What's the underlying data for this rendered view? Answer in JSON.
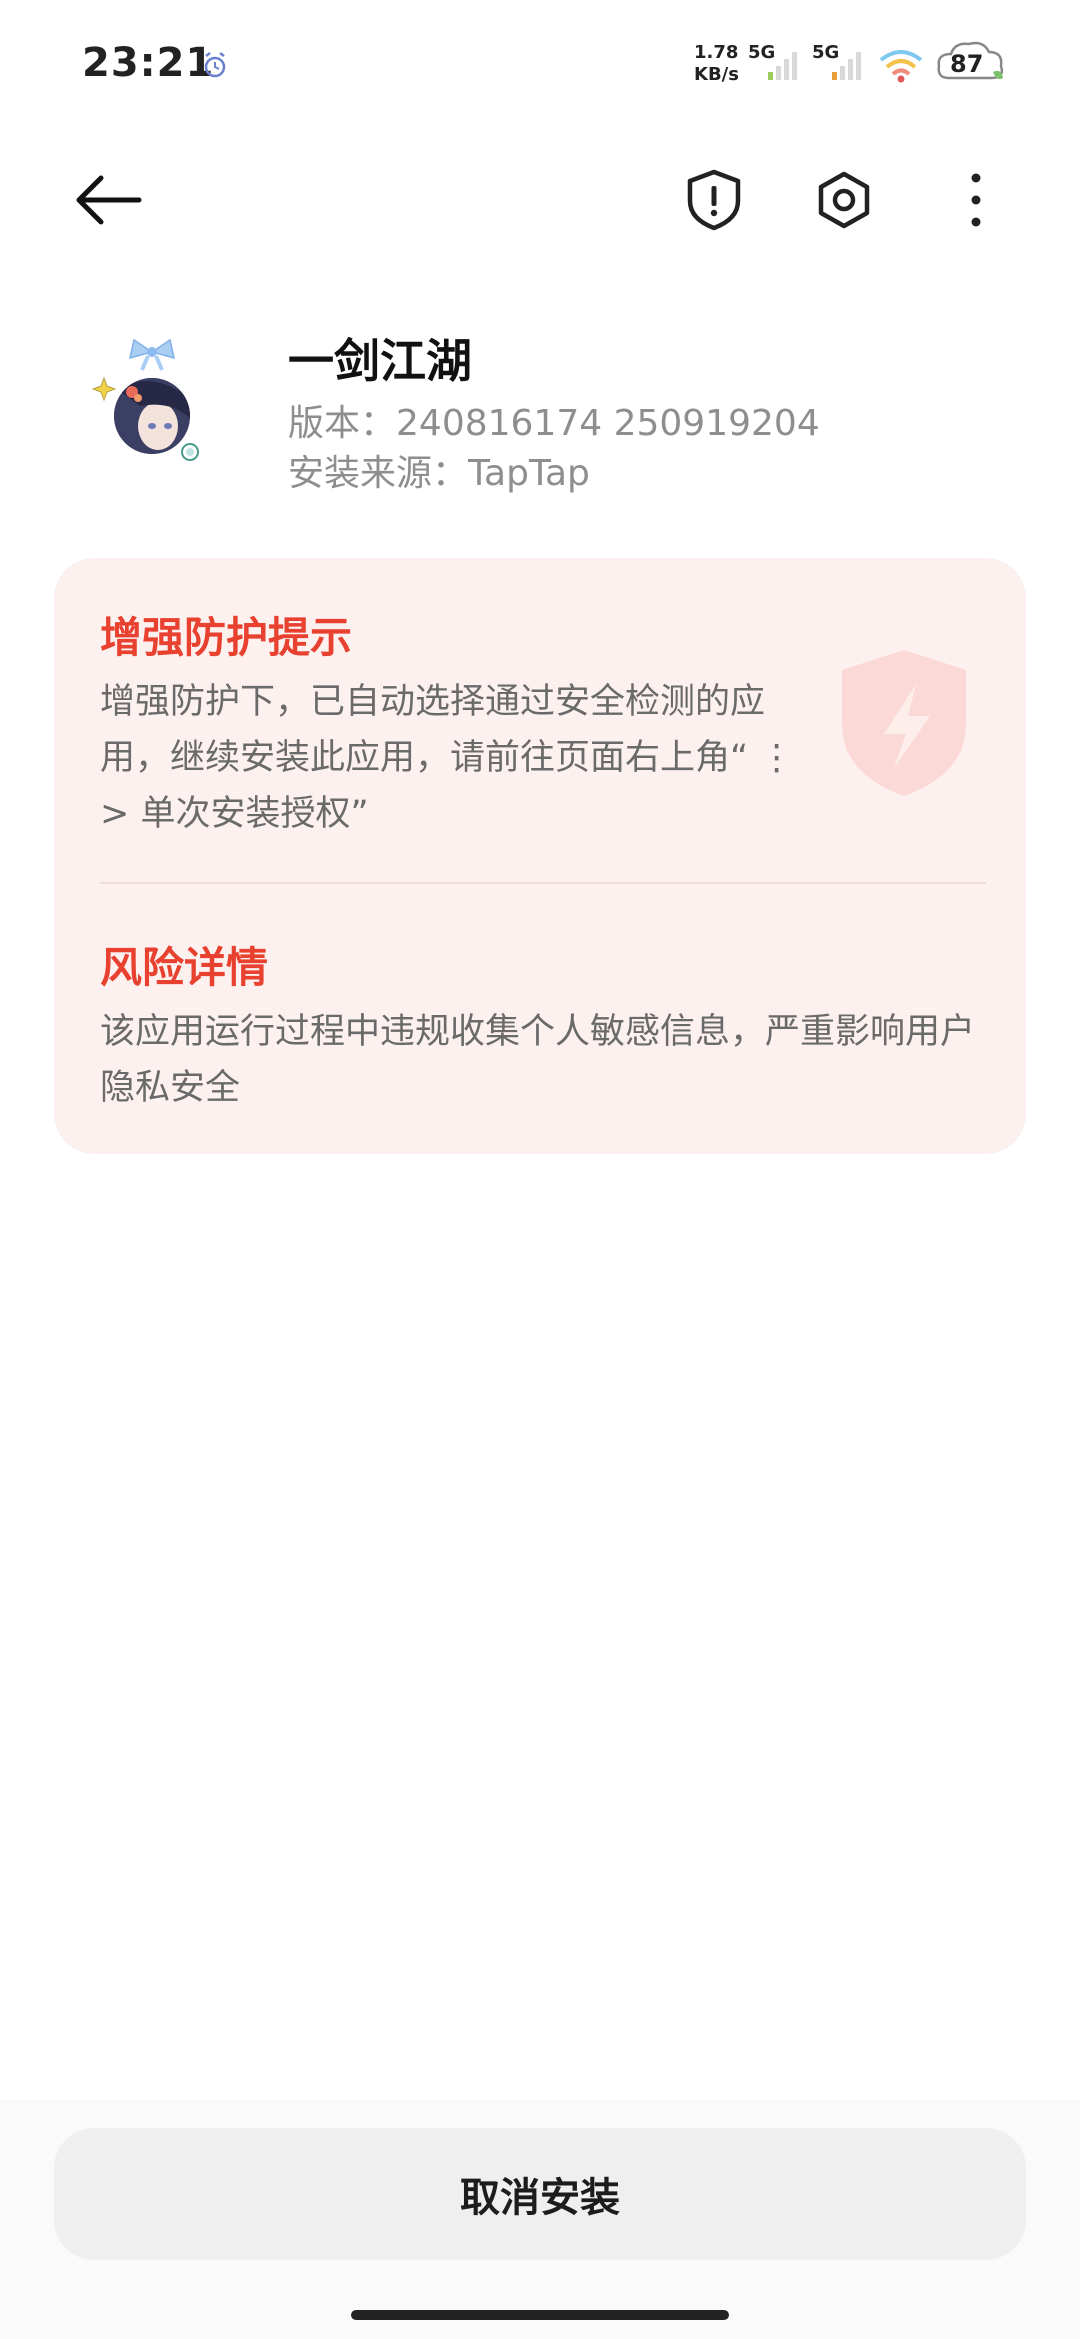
{
  "status_bar": {
    "time": "23:21",
    "net_speed_value": "1.78",
    "net_speed_unit": "KB/s",
    "sim1_type": "5G",
    "sim2_type": "5G",
    "battery": "87",
    "icons": [
      "alarm-icon",
      "signal-icon",
      "signal-icon",
      "wifi-icon",
      "battery-icon"
    ]
  },
  "toolbar": {
    "icons": [
      "back-arrow-icon",
      "shield-warning-icon",
      "settings-hex-icon",
      "more-vertical-icon"
    ]
  },
  "app": {
    "name": "一剑江湖",
    "version_label": "版本：",
    "version_value": "240816174 250919204",
    "source_label": "安装来源：",
    "source_value": "TapTap"
  },
  "warning_card": {
    "protection_title": "增强防护提示",
    "protection_body": "增强防护下，已自动选择通过安全检测的应用，继续安装此应用，请前往页面右上角“ ⋮ > 单次安装授权”",
    "risk_title": "风险详情",
    "risk_body": "该应用运行过程中违规收集个人敏感信息，严重影响用户隐私安全"
  },
  "actions": {
    "cancel_label": "取消安装"
  },
  "colors": {
    "accent_red": "#e8412f",
    "card_bg": "#fdf1f0",
    "button_bg": "#efefef"
  }
}
